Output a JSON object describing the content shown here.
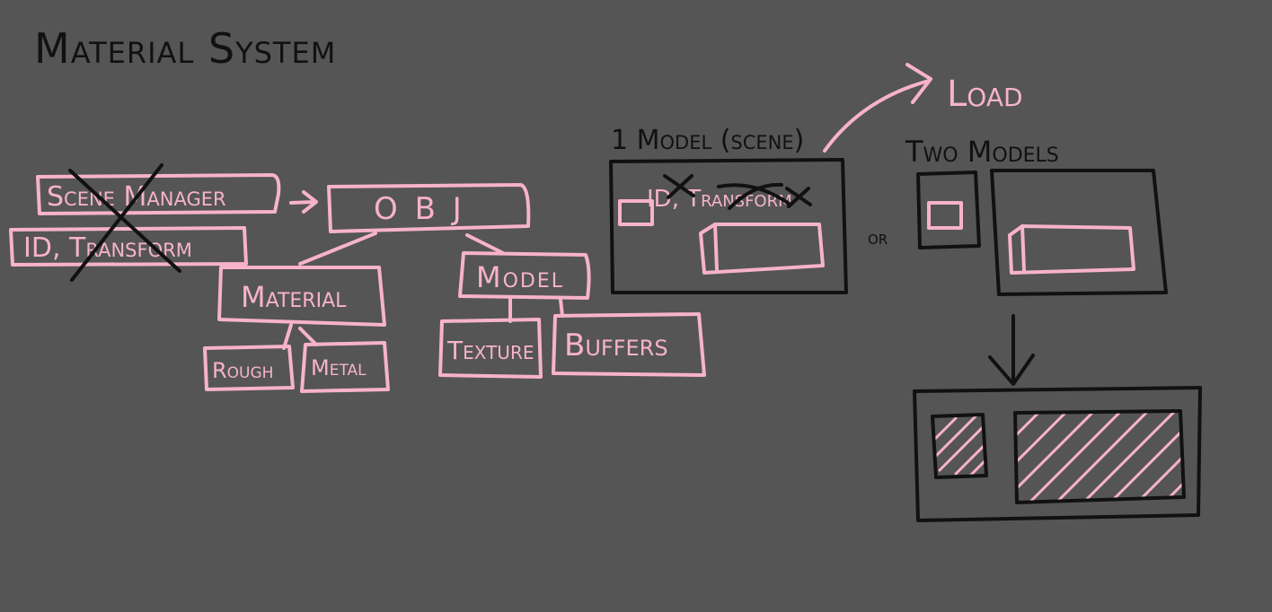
{
  "title": "Material System",
  "left_diagram": {
    "scene_manager": "Scene Manager",
    "id_transform": "ID, Transform",
    "obj": "O B J",
    "material": "Material",
    "rough": "Rough",
    "metal": "Metal",
    "model": "Model",
    "texture": "Texture",
    "buffers": "Buffers"
  },
  "right_diagram": {
    "one_model_label": "1 Model (scene)",
    "one_model_crossed_text": "ID, Transform",
    "load_label": "Load",
    "two_models_label": "Two Models",
    "or_label": "or"
  },
  "colors": {
    "background": "#555555",
    "pink": "#f7b3c9",
    "black": "#111111"
  }
}
